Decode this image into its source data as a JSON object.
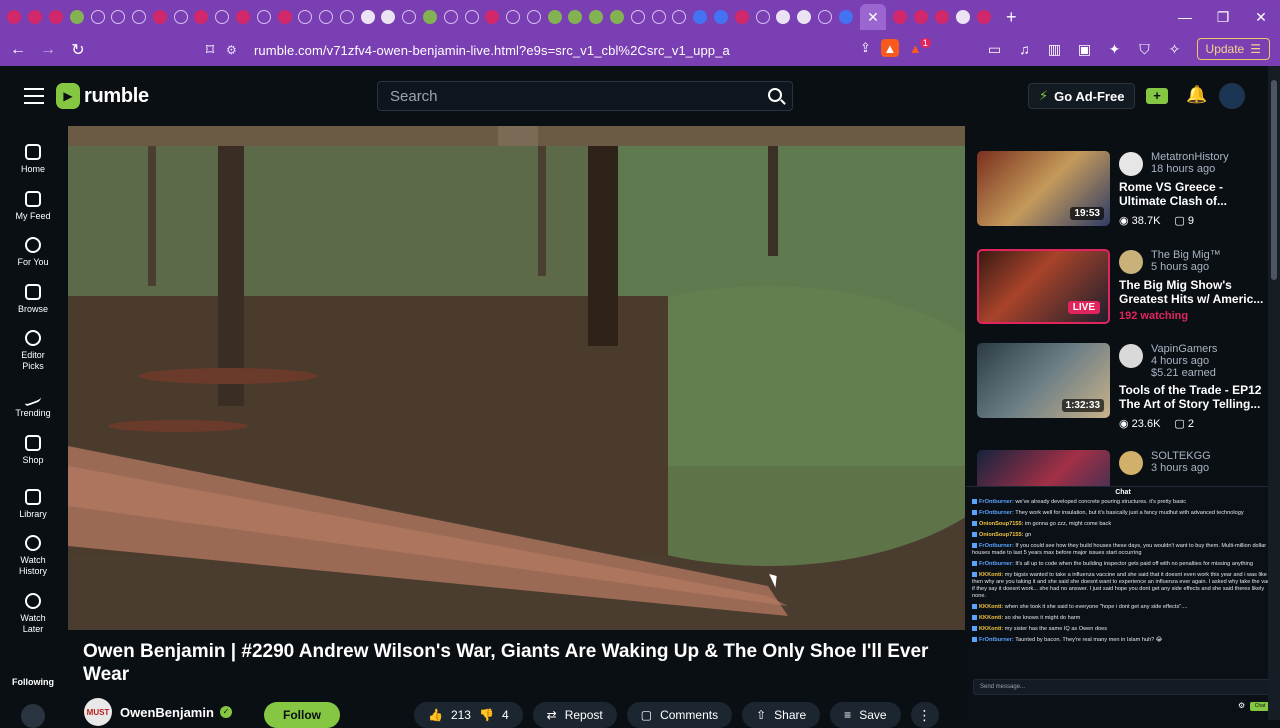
{
  "browser": {
    "url": "rumble.com/v71zfv4-owen-benjamin-live.html?e9s=src_v1_cbl%2Csrc_v1_upp_a",
    "update_label": "Update",
    "brave_count": "1",
    "new_tab": "+",
    "active_tab_close": "✕"
  },
  "header": {
    "logo_text": "rumble",
    "search_placeholder": "Search",
    "go_adfree": "Go Ad-Free"
  },
  "nav": {
    "items": [
      {
        "label": "Home"
      },
      {
        "label": "My Feed"
      },
      {
        "label": "For You"
      },
      {
        "label": "Browse"
      },
      {
        "label": "Editor Picks"
      },
      {
        "label": "Trending"
      },
      {
        "label": "Shop"
      },
      {
        "label": "Library"
      },
      {
        "label": "Watch History"
      },
      {
        "label": "Watch Later"
      }
    ],
    "following": "Following"
  },
  "video": {
    "title": "Owen Benjamin | #2290 Andrew Wilson's War, Giants Are Waking Up & The Only Shoe I'll Ever Wear",
    "channel": "OwenBenjamin",
    "follow": "Follow",
    "likes": "213",
    "dislikes": "4",
    "repost": "Repost",
    "comments": "Comments",
    "share": "Share",
    "save": "Save",
    "avatar_text": "MUST"
  },
  "related": [
    {
      "channel": "MetatronHistory",
      "time": "18 hours ago",
      "title": "Rome VS Greece - Ultimate Clash of...",
      "duration": "19:53",
      "views": "38.7K",
      "comments": "9"
    },
    {
      "channel": "The Big Mig™",
      "time": "5 hours ago",
      "title": "The Big Mig Show's Greatest Hits w/ Americ...",
      "live": "LIVE",
      "watching": "192 watching"
    },
    {
      "channel": "VapinGamers",
      "time": "4 hours ago",
      "earned": "$5.21 earned",
      "title": "Tools of the Trade - EP12 The Art of Story Telling...",
      "duration": "1:32:33",
      "views": "23.6K",
      "comments": "2"
    },
    {
      "channel": "SOLTEKGG",
      "time": "3 hours ago",
      "title": ""
    }
  ],
  "chat": {
    "header": "Chat",
    "messages": [
      {
        "user": "FrOntburner:",
        "text": "we've already developed concrete pouring structures. it's pretty basic"
      },
      {
        "user": "FrOntburner:",
        "text": "They work well for insulation, but it's basically just a fancy mudhut with advanced technology"
      },
      {
        "user": "OnionSoup7155:",
        "text": "im gonna go zzz, might come back"
      },
      {
        "user": "OnionSoup7155:",
        "text": "gn"
      },
      {
        "user": "FrOntburner:",
        "text": "If you could see how they build houses these days, you wouldn't want to buy them. Multi-million dollar houses made to last 5 years max before major issues start occurring"
      },
      {
        "user": "FrOntburner:",
        "text": "It's all up to code when the building inspector gets paid off with no penalties for missing anything"
      },
      {
        "user": "KKKonti:",
        "text": "my bigsis wanted to take a influenza vaccine and she said that it doesnt even work this year and i was like then why are you taking it and she said she doesnt want to experience an influenza ever again. I asked why take the vac if they say it doesnt work... she had no answer. I just said hope you dont get any side effects and she said theres likely none."
      },
      {
        "user": "KKKonti:",
        "text": "when she took it she said to everyone \"hope i dont get any side effects\"...."
      },
      {
        "user": "KKKonti:",
        "text": "so she knows it might do harm"
      },
      {
        "user": "KKKonti:",
        "text": "my sister has the same IQ as Owen does"
      },
      {
        "user": "FrOntburner:",
        "text": "Taunted by bacon. They're real many men in Islam huh? 😂"
      }
    ],
    "input_placeholder": "Send message...",
    "send": "Chat"
  }
}
